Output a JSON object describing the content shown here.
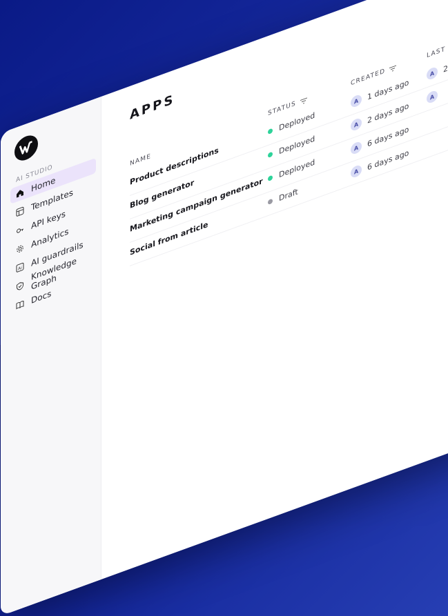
{
  "sidebar": {
    "section_label": "AI STUDIO",
    "items": [
      {
        "label": "Home",
        "icon": "home-icon",
        "active": true
      },
      {
        "label": "Templates",
        "icon": "templates-icon"
      },
      {
        "label": "API keys",
        "icon": "key-icon"
      },
      {
        "label": "Analytics",
        "icon": "gear-icon"
      },
      {
        "label": "AI guardrails",
        "icon": "ai-icon"
      },
      {
        "label": "Knowledge Graph",
        "icon": "lightbulb-icon"
      },
      {
        "label": "Docs",
        "icon": "book-icon"
      }
    ]
  },
  "main": {
    "title": "APPS",
    "columns": {
      "name": "NAME",
      "status": "STATUS",
      "created": "CREATED",
      "last_deployed": "LAST DEPI"
    },
    "rows": [
      {
        "name": "Product descriptions",
        "status": "Deployed",
        "created": "1 days ago",
        "created_avatar": "A",
        "deployed": "2",
        "deployed_avatar": "A"
      },
      {
        "name": "Blog generator",
        "status": "Deployed",
        "created": "2 days ago",
        "created_avatar": "A",
        "deployed": "",
        "deployed_avatar": "A"
      },
      {
        "name": "Marketing campaign generator",
        "status": "Deployed",
        "created": "6 days ago",
        "created_avatar": "A",
        "deployed": "",
        "deployed_avatar": ""
      },
      {
        "name": "Social from article",
        "status": "Draft",
        "created": "6 days ago",
        "created_avatar": "A",
        "deployed": "",
        "deployed_avatar": ""
      }
    ]
  },
  "colors": {
    "deployed": "#2ed39a",
    "draft": "#9a9aa3",
    "active_nav": "#ebe3fb",
    "background": "#14279a"
  }
}
